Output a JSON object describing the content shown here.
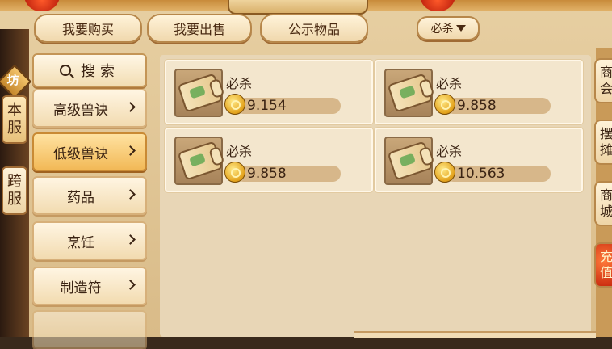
{
  "top_tabs": {
    "buy": "我要购买",
    "sell": "我要出售",
    "public": "公示物品",
    "filter": "必杀"
  },
  "left_side": {
    "badge": "坊",
    "server_local": "本服",
    "server_cross": "跨服"
  },
  "search": {
    "label": "搜索"
  },
  "categories": [
    {
      "label": "高级兽诀"
    },
    {
      "label": "低级兽诀"
    },
    {
      "label": "药品"
    },
    {
      "label": "烹饪"
    },
    {
      "label": "制造符"
    },
    {
      "label": ""
    }
  ],
  "items": [
    {
      "name": "必杀",
      "price": "9.154"
    },
    {
      "name": "必杀",
      "price": "9.858"
    },
    {
      "name": "必杀",
      "price": "9.858"
    },
    {
      "name": "必杀",
      "price": "10.563"
    }
  ],
  "right_side": {
    "tab1": "商会",
    "tab2": "摆摊",
    "tab3": "商城",
    "tab4": "充值"
  },
  "colors": {
    "accent": "#f2b957",
    "panel": "#e8d6b6",
    "text": "#3b2414"
  }
}
